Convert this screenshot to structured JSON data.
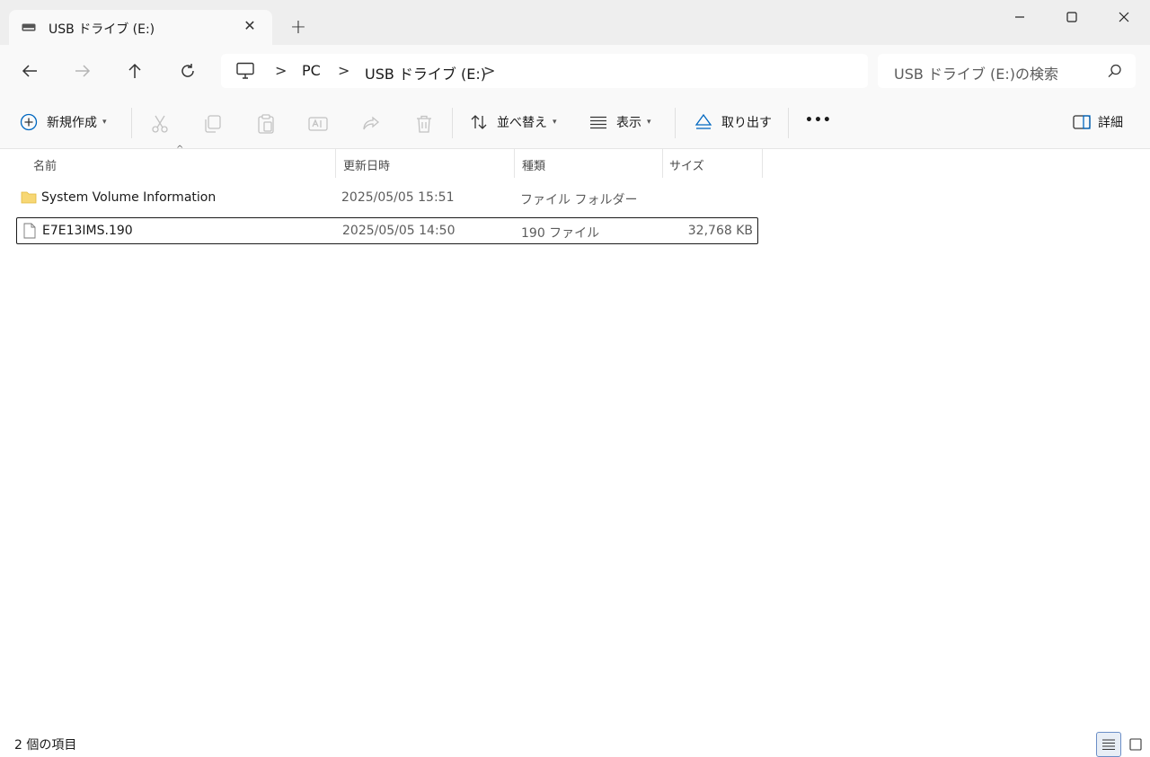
{
  "tab": {
    "title": "USB ドライブ (E:)",
    "close_glyph": "✕",
    "new_tab_glyph": "+"
  },
  "window_controls": {
    "minimize": "minimize-icon",
    "maximize": "maximize-icon",
    "close": "close-icon"
  },
  "navigation": {
    "back": "arrow-left-icon",
    "forward": "arrow-right-icon",
    "up": "arrow-up-icon",
    "refresh": "refresh-icon",
    "breadcrumb": [
      "PC",
      "USB ドライブ (E:)"
    ],
    "separator": ">",
    "search_placeholder": "USB ドライブ (E:)の検索"
  },
  "command_bar": {
    "new_label": "新規作成",
    "sort_label": "並べ替え",
    "view_label": "表示",
    "eject_label": "取り出す",
    "more_label": "•••",
    "details_label": "詳細",
    "disabled_icons": [
      "cut-icon",
      "copy-icon",
      "paste-icon",
      "rename-icon",
      "share-icon",
      "delete-icon"
    ]
  },
  "columns": {
    "name": "名前",
    "date": "更新日時",
    "type": "種類",
    "size": "サイズ"
  },
  "files": [
    {
      "name": "System Volume Information",
      "date": "2025/05/05 15:51",
      "type": "ファイル フォルダー",
      "size": "",
      "icon": "folder-icon"
    },
    {
      "name": "E7E13IMS.190",
      "date": "2025/05/05 14:50",
      "type": "190 ファイル",
      "size": "32,768 KB",
      "icon": "file-icon",
      "selected": true
    }
  ],
  "status": {
    "item_count": "2 個の項目"
  },
  "colors": {
    "accent": "#0067c0",
    "folder": "#f7d774",
    "chrome": "#eeeeee"
  }
}
